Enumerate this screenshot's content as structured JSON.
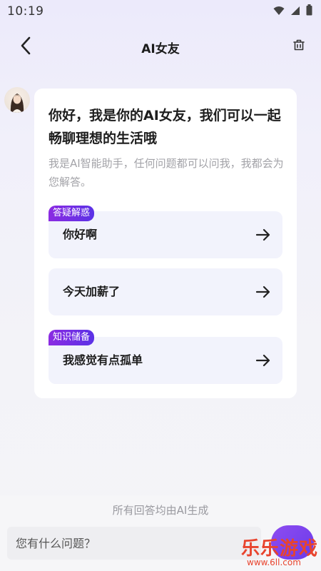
{
  "status_bar": {
    "time": "10:19",
    "icons": [
      "wifi-icon",
      "signal-icon",
      "battery-icon"
    ]
  },
  "header": {
    "title": "AI女友",
    "back_icon": "chevron-left-icon",
    "clear_icon": "trash-icon"
  },
  "message": {
    "avatar": "assistant-avatar",
    "greeting": "你好，我是你的AI女友，我们可以一起畅聊理想的生活哦",
    "subtext": "我是AI智能助手，任何问题都可以问我，我都会为您解答。",
    "suggestions": [
      {
        "tag": "答疑解惑",
        "text": "你好啊"
      },
      {
        "tag": "",
        "text": "今天加薪了"
      },
      {
        "tag": "知识储备",
        "text": "我感觉有点孤单"
      }
    ]
  },
  "footer": {
    "disclaimer": "所有回答均由AI生成",
    "input_placeholder": "您有什么问题？",
    "input_value": ""
  },
  "watermark": {
    "main": "乐乐游戏",
    "sub": "www.6ll.com"
  },
  "colors": {
    "accent": "#6A3BEA",
    "tag_start": "#8B2BE2",
    "tag_end": "#5B32E6",
    "suggestion_bg": "#F2F3FC",
    "watermark": "#E8442E"
  }
}
